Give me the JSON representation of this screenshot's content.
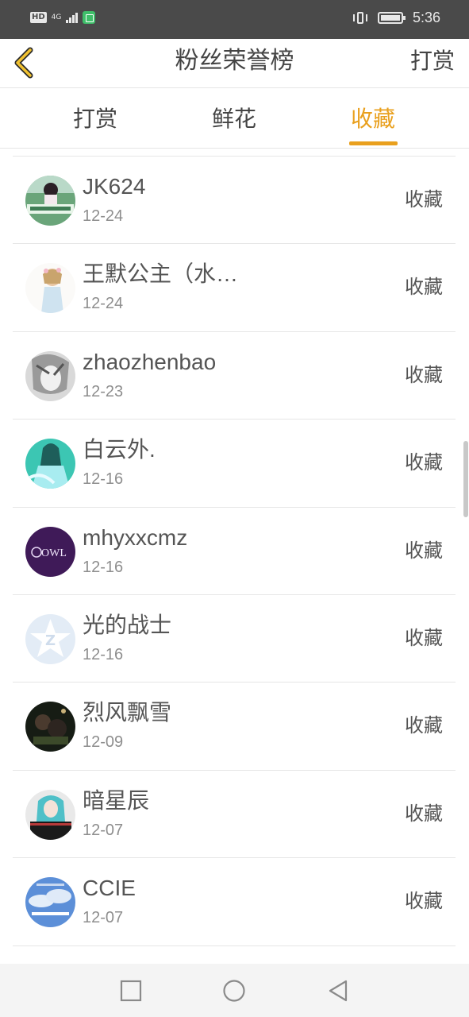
{
  "status_bar": {
    "left_hd": "HD",
    "left_net": "4G",
    "time": "5:36"
  },
  "header": {
    "title": "粉丝荣誉榜",
    "right_action": "打赏"
  },
  "tabs": [
    {
      "label": "打赏"
    },
    {
      "label": "鲜花"
    },
    {
      "label": "收藏",
      "active": true
    }
  ],
  "colors": {
    "accent": "#e9a01e",
    "text": "#444444",
    "muted": "#8e8e8e",
    "divider": "#e6e6e6"
  },
  "list": [
    {
      "name": "JK624",
      "date": "12-24",
      "action": "收藏"
    },
    {
      "name": "王默公主（水…",
      "date": "12-24",
      "action": "收藏"
    },
    {
      "name": "zhaozhenbao",
      "date": "12-23",
      "action": "收藏"
    },
    {
      "name": "白云外.",
      "date": "12-16",
      "action": "收藏"
    },
    {
      "name": "mhyxxcmz",
      "date": "12-16",
      "action": "收藏"
    },
    {
      "name": "光的战士",
      "date": "12-16",
      "action": "收藏"
    },
    {
      "name": "烈风飘雪",
      "date": "12-09",
      "action": "收藏"
    },
    {
      "name": "暗星辰",
      "date": "12-07",
      "action": "收藏"
    },
    {
      "name": "CCIE",
      "date": "12-07",
      "action": "收藏"
    }
  ],
  "avatars": [
    {
      "label": "OWL"
    },
    {
      "label": "Z"
    }
  ]
}
